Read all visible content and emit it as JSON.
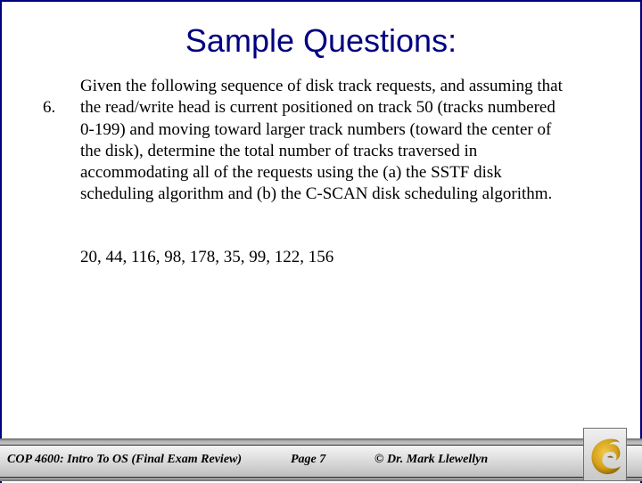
{
  "slide": {
    "title": "Sample Questions:",
    "question_number": "6.",
    "question_text": "Given the following sequence of disk track requests, and assuming that the read/write head is current positioned on track 50 (tracks numbered 0-199) and moving toward larger track numbers (toward the center of the disk), determine the total number of tracks traversed in accommodating all of the requests using the (a) the SSTF disk scheduling algorithm and (b) the C-SCAN disk scheduling algorithm.",
    "request_sequence": "20, 44, 116, 98, 178, 35, 99, 122, 156"
  },
  "footer": {
    "course": "COP 4600: Intro To OS  (Final Exam Review)",
    "page": "Page 7",
    "copyright": "© Dr. Mark Llewellyn",
    "logo_icon": "pegasus-logo-icon"
  },
  "colors": {
    "title": "#000080",
    "border": "#000080",
    "logo_gold": "#d4a017"
  }
}
